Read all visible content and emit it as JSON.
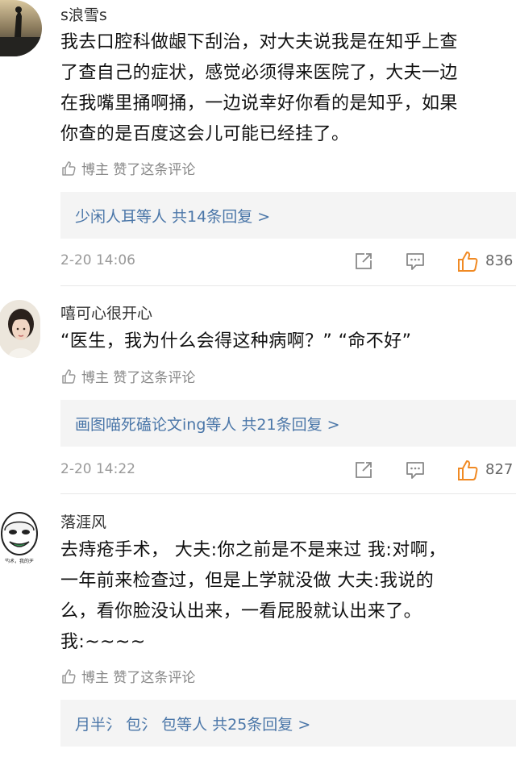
{
  "comments": [
    {
      "username": "s浪雪s",
      "text_lines": [
        "我去口腔科做龈下刮治，对大夫说我是在知乎上查",
        "了查自己的症状，感觉必须得来医院了，大夫一边",
        "在我嘴里捅啊捅，一边说幸好你看的是知乎，如果",
        "你查的是百度这会儿可能已经挂了。"
      ],
      "liked_label": "博主 赞了这条评论",
      "replies_label": "少闲人耳等人 共14条回复 >",
      "date": "2-20 14:06",
      "like_count": "836"
    },
    {
      "username": "嘻可心很开心",
      "text_lines": [
        "“医生，我为什么会得这种病啊？” “命不好”"
      ],
      "liked_label": "博主 赞了这条评论",
      "replies_label": "画图喵死磕论文ing等人 共21条回复 >",
      "date": "2-20 14:22",
      "like_count": "827"
    },
    {
      "username": "落涯风",
      "text_lines": [
        "去痔疮手术， 大夫:你之前是不是来过 我:对啊，",
        "一年前来检查过，但是上学就没做 大夫:我说的",
        "么，看你脸没认出来，一看屁股就认出来了。",
        "我:~~~~"
      ],
      "liked_label": "博主 赞了这条评论",
      "replies_label": "月半氵 包氵 包等人 共25条回复 >",
      "avatar_caption": "的术，我的天"
    }
  ],
  "colors": {
    "link_blue": "#4a76a8",
    "like_orange": "#f08a24",
    "gray_text": "#888888",
    "reply_bg": "#f4f4f4"
  }
}
